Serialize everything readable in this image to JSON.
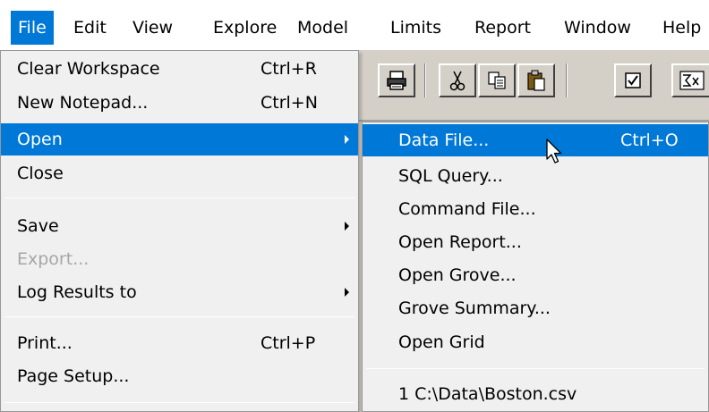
{
  "menubar": {
    "items": [
      {
        "label": "File",
        "active": true
      },
      {
        "label": "Edit"
      },
      {
        "label": "View"
      },
      {
        "label": "Explore"
      },
      {
        "label": "Model"
      },
      {
        "label": "Limits"
      },
      {
        "label": "Report"
      },
      {
        "label": "Window"
      },
      {
        "label": "Help"
      }
    ]
  },
  "toolbar": {
    "buttons": [
      {
        "icon": "print-icon"
      },
      {
        "icon": "cut-icon"
      },
      {
        "icon": "copy-icon"
      },
      {
        "icon": "paste-icon"
      },
      {
        "icon": "checkbox-icon"
      },
      {
        "icon": "formula-icon"
      }
    ]
  },
  "file_menu": {
    "items": [
      {
        "label": "Clear Workspace",
        "shortcut": "Ctrl+R"
      },
      {
        "label": "New Notepad...",
        "shortcut": "Ctrl+N"
      },
      {
        "label": "Open",
        "submenu": true,
        "highlighted": true
      },
      {
        "label": "Close"
      },
      {
        "label": "Save",
        "submenu": true
      },
      {
        "label": "Export...",
        "disabled": true
      },
      {
        "label": "Log Results to",
        "submenu": true
      },
      {
        "label": "Print...",
        "shortcut": "Ctrl+P"
      },
      {
        "label": "Page Setup..."
      }
    ]
  },
  "open_submenu": {
    "items": [
      {
        "label": "Data File...",
        "shortcut": "Ctrl+O",
        "highlighted": true
      },
      {
        "label": "SQL Query..."
      },
      {
        "label": "Command File..."
      },
      {
        "label": "Open Report..."
      },
      {
        "label": "Open Grove..."
      },
      {
        "label": "Grove Summary..."
      },
      {
        "label": "Open Grid"
      },
      {
        "label": "1 C:\\Data\\Boston.csv"
      }
    ]
  },
  "colors": {
    "highlight": "#0078d7",
    "menu_bg": "#f0f0f0",
    "app_bg": "#d4d0c8",
    "disabled_text": "#a6a6a6"
  }
}
